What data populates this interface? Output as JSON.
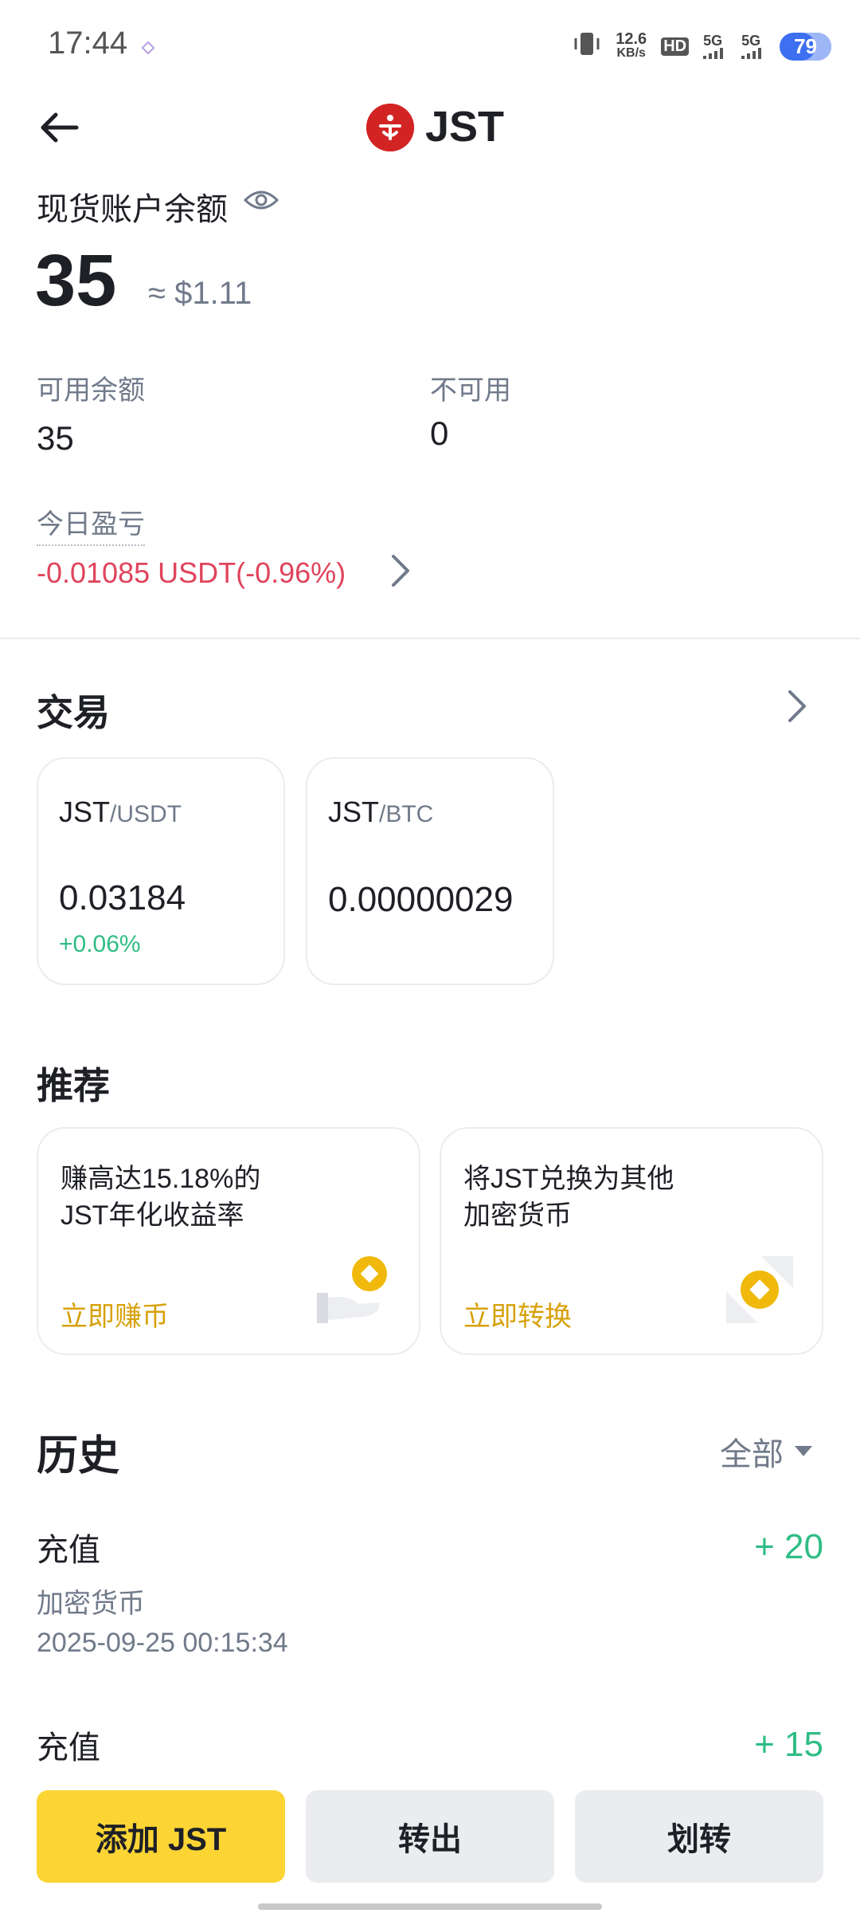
{
  "status_bar": {
    "time": "17:44",
    "net_speed_top": "12.6",
    "net_speed_unit": "KB/s",
    "hd": "HD",
    "sim1": "5G",
    "sim2": "5G",
    "battery": "79"
  },
  "header": {
    "title": "JST",
    "logo_color": "#d32424"
  },
  "balance": {
    "label": "现货账户余额",
    "value": "35",
    "usd": "≈ $1.11",
    "available_label": "可用余额",
    "available_value": "35",
    "unavailable_label": "不可用",
    "unavailable_value": "0",
    "pnl_label": "今日盈亏",
    "pnl_value": "-0.01085 USDT(-0.96%)"
  },
  "trade": {
    "title": "交易",
    "pairs": [
      {
        "base": "JST",
        "quote": "/USDT",
        "price": "0.03184",
        "change": "+0.06%"
      },
      {
        "base": "JST",
        "quote": "/BTC",
        "price": "0.00000029",
        "change": ""
      }
    ]
  },
  "recommend": {
    "title": "推荐",
    "cards": [
      {
        "line1": "赚高达15.18%的",
        "line2": "JST年化收益率",
        "action": "立即赚币"
      },
      {
        "line1": "将JST兑换为其他",
        "line2": "加密货币",
        "action": "立即转换"
      }
    ]
  },
  "history": {
    "title": "历史",
    "filter": "全部",
    "items": [
      {
        "type": "充值",
        "sub": "加密货币",
        "time": "2025-09-25 00:15:34",
        "amount": "+ 20"
      },
      {
        "type": "充值",
        "sub": "",
        "time": "",
        "amount": "+ 15"
      }
    ]
  },
  "actions": {
    "add": "添加 JST",
    "withdraw": "转出",
    "transfer": "划转"
  },
  "colors": {
    "accent_yellow": "#fcd535",
    "positive": "#2ebd85",
    "negative": "#e0435c"
  }
}
